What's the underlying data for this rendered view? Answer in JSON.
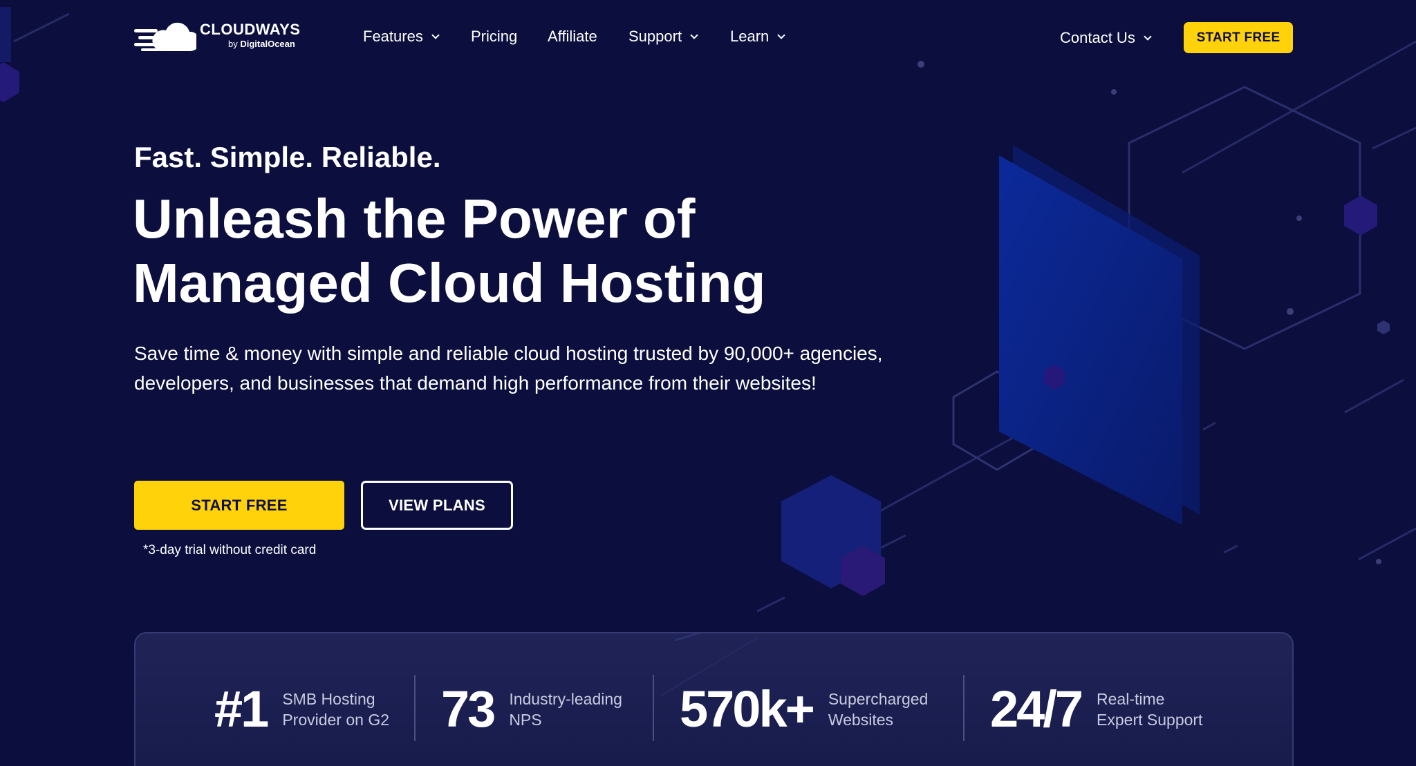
{
  "brand": {
    "name": "CLOUDWAYS",
    "sub_by": "by",
    "sub_company": "DigitalOcean"
  },
  "nav": {
    "items": [
      {
        "label": "Features",
        "has_dropdown": true
      },
      {
        "label": "Pricing",
        "has_dropdown": false
      },
      {
        "label": "Affiliate",
        "has_dropdown": false
      },
      {
        "label": "Support",
        "has_dropdown": true
      },
      {
        "label": "Learn",
        "has_dropdown": true
      }
    ],
    "contact": {
      "label": "Contact Us",
      "has_dropdown": true
    },
    "cta_label": "START FREE",
    "dropdown_icon": "chevron-down-icon"
  },
  "hero": {
    "tagline": "Fast. Simple. Reliable.",
    "headline_line1": "Unleash the Power of",
    "headline_line2": "Managed Cloud Hosting",
    "description": "Save time & money with simple and reliable cloud hosting trusted by 90,000+ agencies, developers, and businesses that demand high performance from their websites!",
    "primary_cta": "START FREE",
    "secondary_cta": "VIEW PLANS",
    "trial_note": "*3-day trial without credit card"
  },
  "stats": [
    {
      "value": "#1",
      "label_line1": "SMB Hosting",
      "label_line2": "Provider on G2"
    },
    {
      "value": "73",
      "label_line1": "Industry-leading",
      "label_line2": "NPS"
    },
    {
      "value": "570k+",
      "label_line1": "Supercharged",
      "label_line2": "Websites"
    },
    {
      "value": "24/7",
      "label_line1": "Real-time",
      "label_line2": "Expert Support"
    }
  ],
  "colors": {
    "background": "#0c0f3d",
    "accent_yellow": "#ffd20a",
    "panel_blue": "#0a1f7a",
    "hex_purple": "#2a1a7a"
  }
}
